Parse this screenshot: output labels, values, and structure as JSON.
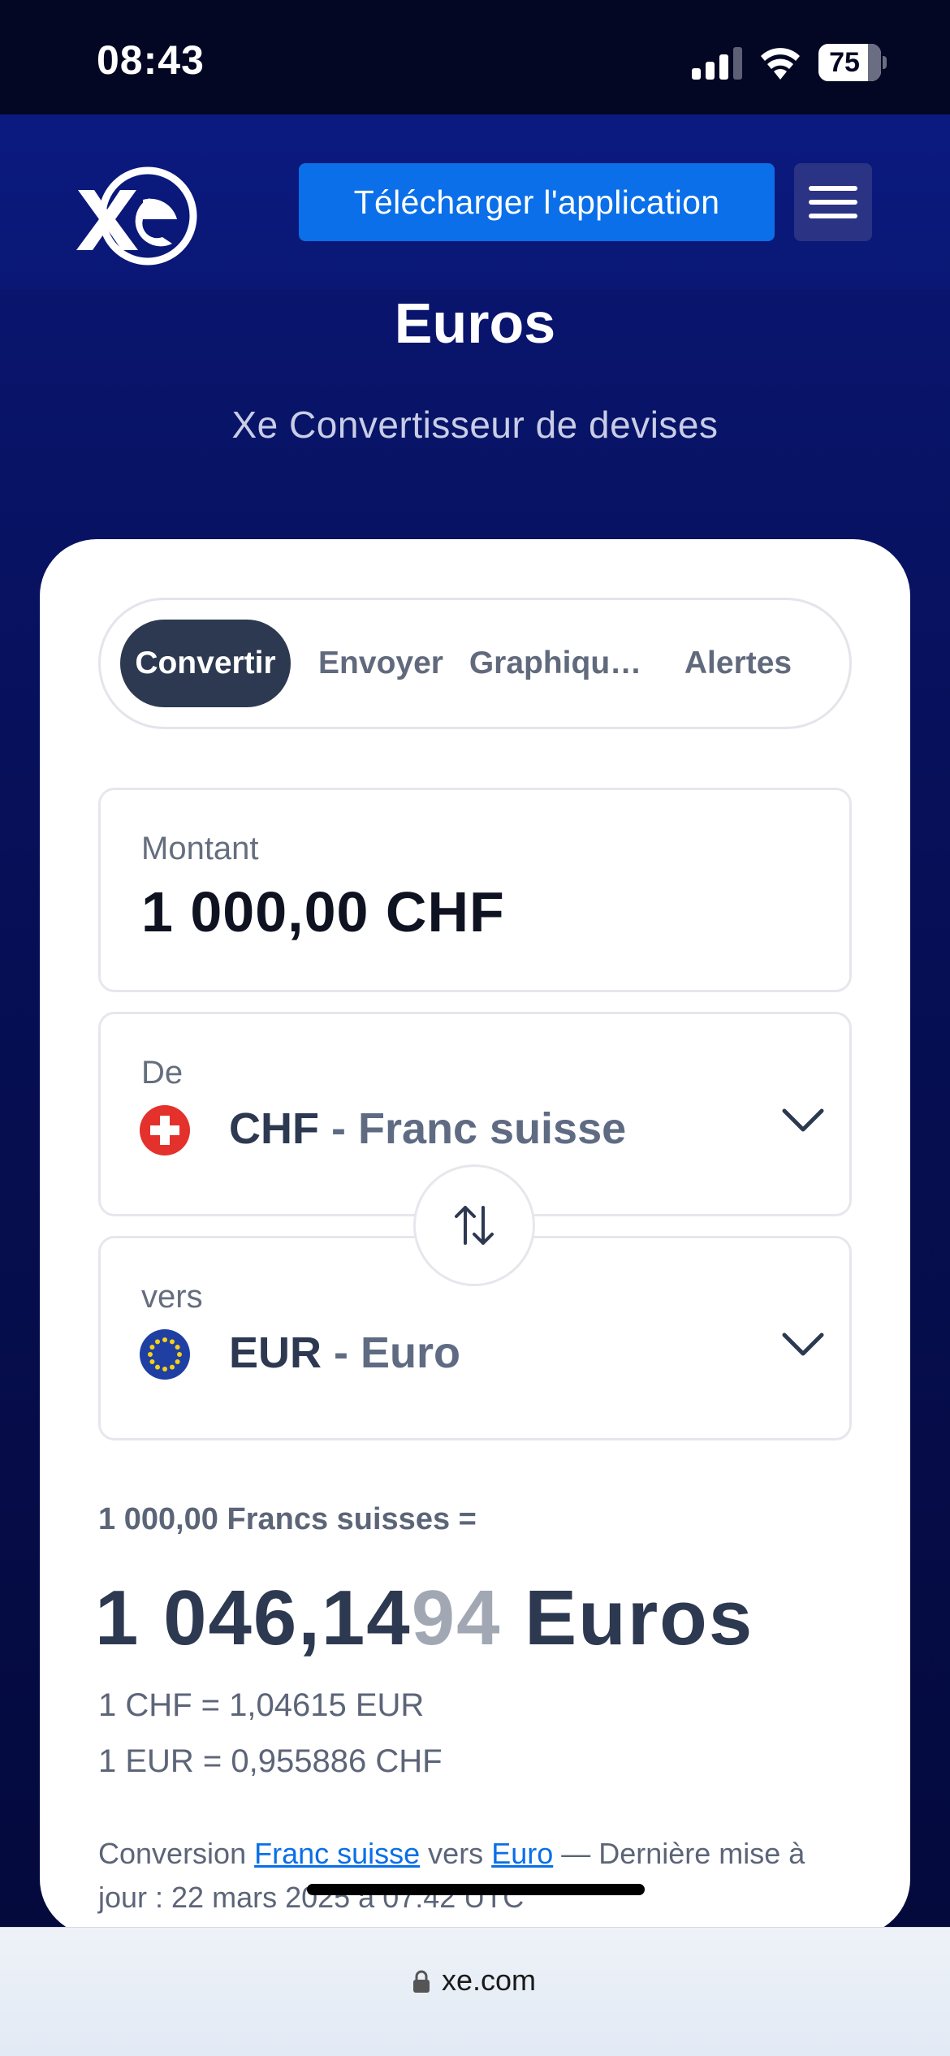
{
  "status_bar": {
    "time": "08:43",
    "battery": "75"
  },
  "header": {
    "download_label": "Télécharger l'application"
  },
  "page": {
    "title": "Euros",
    "subtitle": "Xe Convertisseur de devises"
  },
  "tabs": [
    {
      "label": "Convertir",
      "active": true
    },
    {
      "label": "Envoyer",
      "active": false
    },
    {
      "label": "Graphiqu…",
      "active": false
    },
    {
      "label": "Alertes",
      "active": false
    }
  ],
  "amount": {
    "label": "Montant",
    "value": "1 000,00  CHF"
  },
  "from": {
    "label": "De",
    "code": "CHF",
    "separator": " - ",
    "name": "Franc suisse",
    "flag_icon": "swiss-flag-icon"
  },
  "to": {
    "label": "vers",
    "code": "EUR",
    "separator": " - ",
    "name": "Euro",
    "flag_icon": "eu-flag-icon"
  },
  "result": {
    "from_text": "1 000,00 Francs suisses =",
    "main": "1 046,14",
    "faded": "94",
    "unit": " Euros",
    "rate1": "1 CHF = 1,04615 EUR",
    "rate2": "1 EUR = 0,955886 CHF"
  },
  "update": {
    "prefix": "Conversion ",
    "link1": "Franc suisse",
    "middle": " vers ",
    "link2": "Euro",
    "suffix": " — Dernière mise à jour : 22 mars 2025 à 07:42 UTC"
  },
  "browser": {
    "url": "xe.com"
  },
  "colors": {
    "brand_blue": "#0a6fe8",
    "navy": "#0a1775",
    "active_tab": "#2d3950"
  }
}
